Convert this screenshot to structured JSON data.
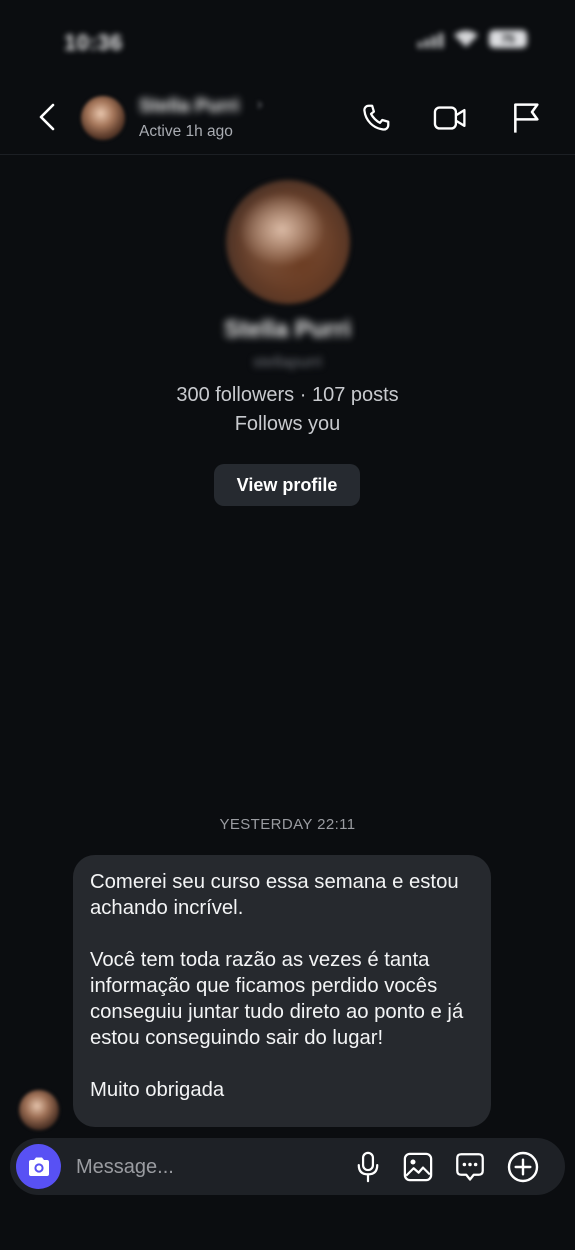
{
  "status_bar": {
    "time": "10:36",
    "battery": "75"
  },
  "header": {
    "contact_name": "Stella Purri",
    "active_status": "Active 1h ago",
    "icons": [
      "back-icon",
      "phone-icon",
      "video-icon",
      "flag-icon"
    ]
  },
  "profile": {
    "name": "Stella Purri",
    "handle": "stellapurri",
    "stats": "300 followers · 107 posts",
    "follows_you": "Follows you",
    "view_profile_label": "View profile"
  },
  "thread": {
    "timestamp": "YESTERDAY 22:11",
    "message_paragraphs": [
      "Comerei seu curso essa semana e estou achando incrível.",
      "Você tem toda razão as vezes é tanta informação que ficamos perdido vocês conseguiu juntar tudo direto ao ponto e já estou conseguindo sair do lugar!",
      "Muito obrigada"
    ]
  },
  "composer": {
    "placeholder": "Message...",
    "icons": [
      "camera-icon",
      "microphone-icon",
      "gallery-icon",
      "sticker-icon",
      "add-icon"
    ]
  },
  "colors": {
    "background": "#0b0d10",
    "bubble": "#26292e",
    "composer": "#1e2126",
    "camera_button": "#5851f4",
    "view_profile_button": "#262a30"
  }
}
